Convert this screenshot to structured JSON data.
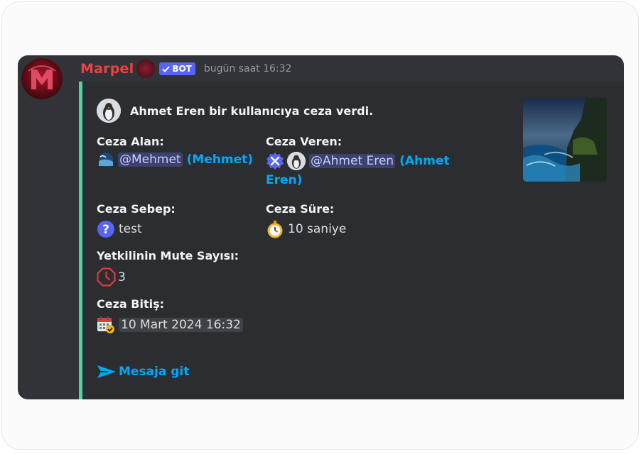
{
  "message": {
    "username": "Marpel",
    "bot_tag": "BOT",
    "timestamp": "bugün saat 16:32"
  },
  "embed": {
    "accent_color": "#4fd69c",
    "author": "Ahmet Eren bir kullanıcıya ceza verdi.",
    "fields": {
      "ceza_alan": {
        "name": "Ceza Alan:",
        "mention": "@Mehmet",
        "paren": "(Mehmet)"
      },
      "ceza_veren": {
        "name": "Ceza Veren:",
        "mention": "@Ahmet Eren",
        "paren1": "(Ahmet",
        "paren2": "Eren)"
      },
      "ceza_sebep": {
        "name": "Ceza Sebep:",
        "icon": "question-icon",
        "value": "test"
      },
      "ceza_sure": {
        "name": "Ceza Süre:",
        "icon": "stopwatch-icon",
        "value": "10 saniye"
      },
      "mute_sayisi": {
        "name": "Yetkilinin Mute Sayısı:",
        "icon": "clock-octagon-icon",
        "value": "3"
      },
      "ceza_bitis": {
        "name": "Ceza Bitiş:",
        "icon": "calendar-check-icon",
        "value": "10 Mart 2024 16:32"
      }
    },
    "link_label": "Mesaja git"
  }
}
